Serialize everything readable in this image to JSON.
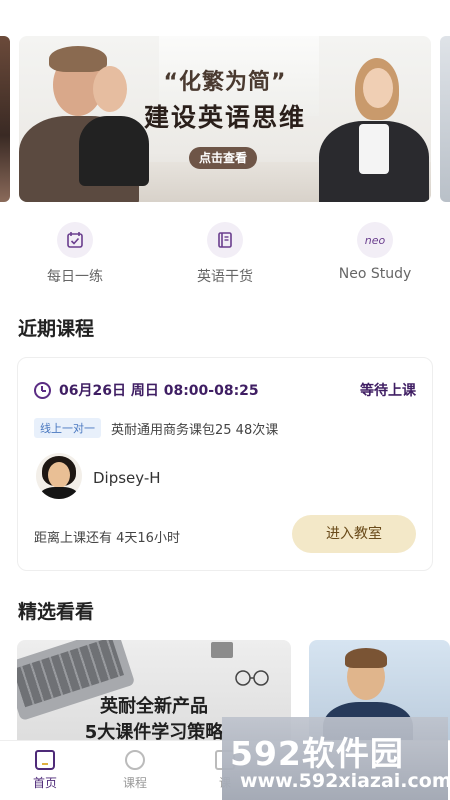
{
  "banner": {
    "title_line1": "“化繁为简”",
    "title_line2": "建设英语思维",
    "cta": "点击查看"
  },
  "quick_entries": [
    {
      "label": "每日一练",
      "icon": "calendar-check-icon"
    },
    {
      "label": "英语干货",
      "icon": "book-icon"
    },
    {
      "label": "Neo Study",
      "icon": "neo-logo-icon",
      "glyph": "neo"
    }
  ],
  "recent": {
    "section_title": "近期课程",
    "course": {
      "date_time": "06月26日 周日 08:00-08:25",
      "status": "等待上课",
      "tag": "线上一对一",
      "name": "英耐通用商务课包25 48次课",
      "teacher": "Dipsey-H",
      "countdown": "距离上课还有 4天16小时",
      "enter_button": "进入教室"
    }
  },
  "featured": {
    "section_title": "精选看看",
    "cards": [
      {
        "line1": "英耐全新产品",
        "line2": "5大课件学习策略"
      }
    ]
  },
  "bottom_nav": [
    {
      "label": "首页",
      "icon": "home-icon",
      "active": true
    },
    {
      "label": "课程",
      "icon": "alarm-clock-icon",
      "active": false
    },
    {
      "label": "课",
      "icon": "calendar-icon",
      "active": false
    }
  ],
  "watermark": {
    "main": "592软件园",
    "sub": "www.592xiazai.com"
  },
  "colors": {
    "brand_purple": "#4e2a78",
    "enter_button_bg": "#f3e8c8",
    "tag_bg": "#e8f0fb"
  }
}
